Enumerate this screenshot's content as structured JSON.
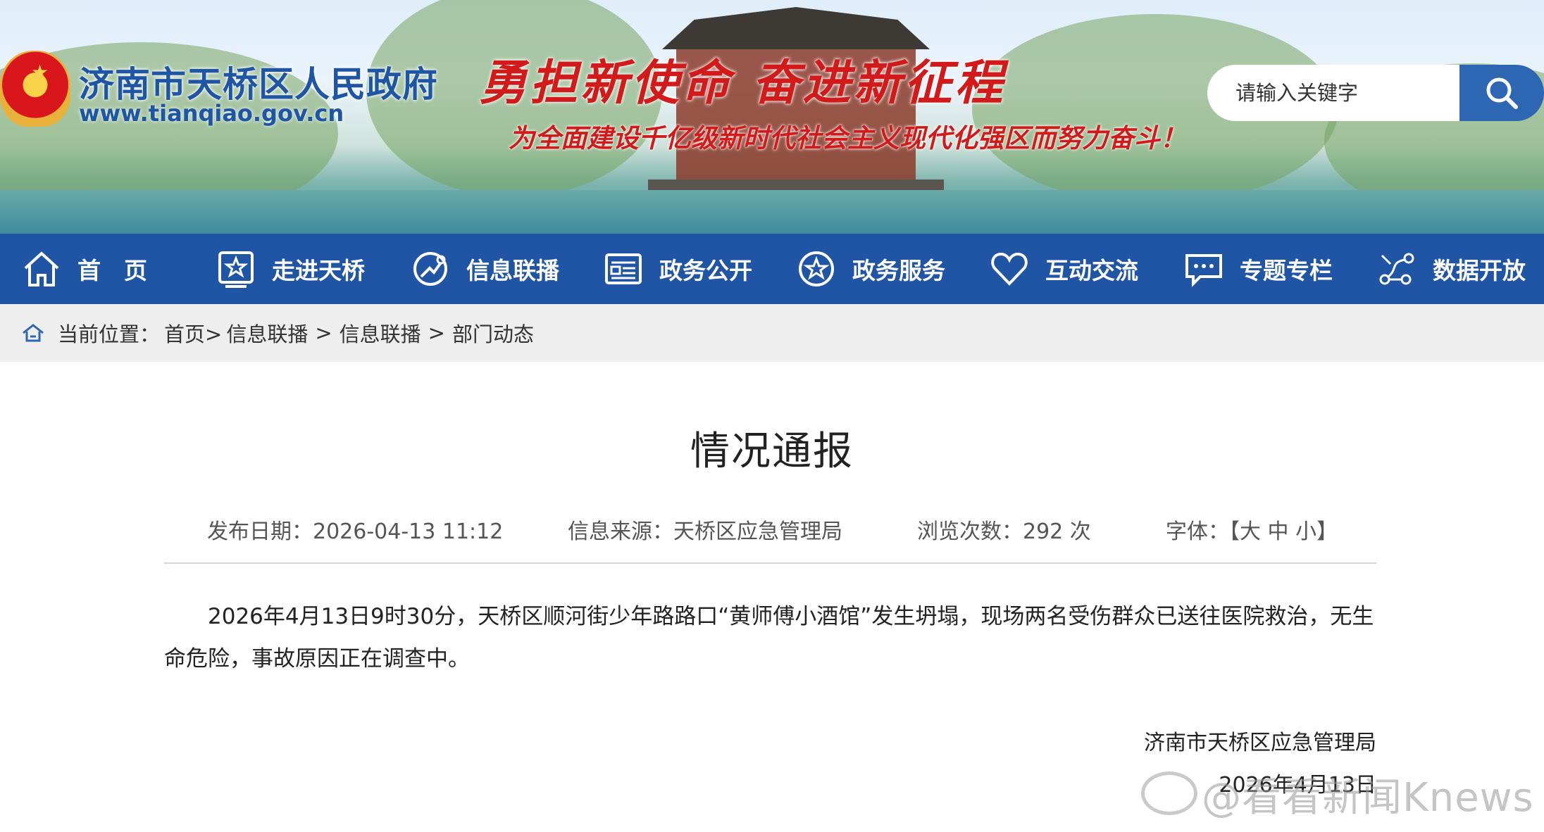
{
  "header": {
    "site_title": "济南市天桥区人民政府",
    "site_url": "www.tianqiao.gov.cn",
    "slogan_main": "勇担新使命  奋进新征程",
    "slogan_sub": "为全面建设千亿级新时代社会主义现代化强区而努力奋斗！",
    "search_placeholder": "请输入关键字"
  },
  "nav": {
    "items": [
      {
        "label": "首　页",
        "icon": "home-icon"
      },
      {
        "label": "走进天桥",
        "icon": "star-badge-icon"
      },
      {
        "label": "信息联播",
        "icon": "broadcast-icon"
      },
      {
        "label": "政务公开",
        "icon": "document-icon"
      },
      {
        "label": "政务服务",
        "icon": "star-circle-icon"
      },
      {
        "label": "互动交流",
        "icon": "heart-icon"
      },
      {
        "label": "专题专栏",
        "icon": "chat-icon"
      },
      {
        "label": "数据开放",
        "icon": "data-icon"
      }
    ]
  },
  "breadcrumb": {
    "prefix": "当前位置：",
    "items": [
      "首页>",
      "信息联播",
      ">",
      "信息联播",
      ">",
      "部门动态"
    ]
  },
  "article": {
    "title": "情况通报",
    "publish_date": "发布日期：2026-04-13 11:12",
    "source": "信息来源：天桥区应急管理局",
    "views": "浏览次数：292 次",
    "font_size": "字体：【大 中 小】",
    "body": "2026年4月13日9时30分，天桥区顺河街少年路路口“黄师傅小酒馆”发生坍塌，现场两名受伤群众已送往医院救治，无生命危险，事故原因正在调查中。",
    "signature": "济南市天桥区应急管理局",
    "sign_date": "2026年4月13日"
  },
  "watermark": "@看看新闻Knews",
  "colors": {
    "nav_bg": "#1f55a4",
    "search_btn": "#2d66b3",
    "site_title": "#1e55a5",
    "slogan": "#d31a1a",
    "crumb_bg": "#eeeeee"
  }
}
